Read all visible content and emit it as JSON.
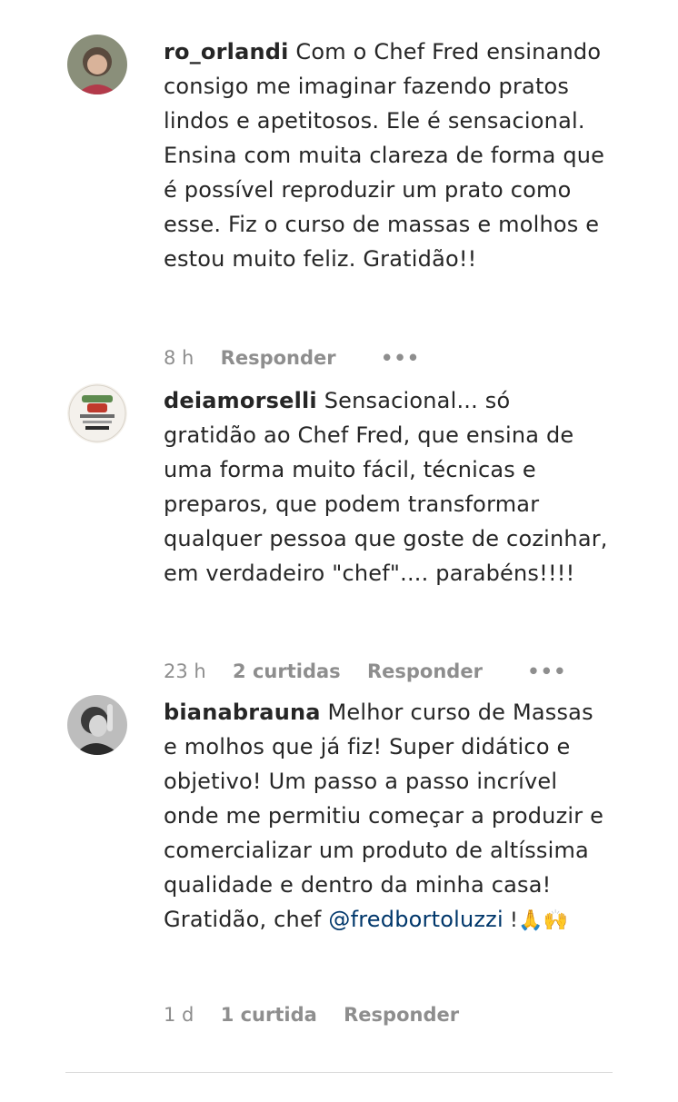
{
  "comments": [
    {
      "username": "ro_orlandi",
      "text": "Com o Chef Fred ensinando consigo me imaginar fazendo pratos lindos e apetitosos. Ele é sensacional. Ensina com muita clareza de forma que é possível reproduzir um prato como esse. Fiz o curso de massas e molhos e estou muito feliz. Gratidão!!",
      "time": "8 h",
      "likes": "",
      "reply": "Responder",
      "more": "•••"
    },
    {
      "username": "deiamorselli",
      "text": "Sensacional... só gratidão ao Chef Fred, que ensina de uma forma muito fácil, técnicas e preparos, que podem transformar qualquer pessoa que goste de cozinhar, em verdadeiro \"chef\".... parabéns!!!!",
      "time": "23 h",
      "likes": "2 curtidas",
      "reply": "Responder",
      "more": "•••"
    },
    {
      "username": "bianabrauna",
      "text": "Melhor curso de Massas e molhos que já fiz! Super didático e objetivo! Um passo a passo incrível onde me permitiu começar a produzir e comercializar um produto de altíssima qualidade e dentro da minha casa! Gratidão, chef",
      "mention": "@fredbortoluzzi",
      "suffix": " !🙏🙌",
      "time": "1 d",
      "likes": "1 curtida",
      "reply": "Responder"
    }
  ]
}
